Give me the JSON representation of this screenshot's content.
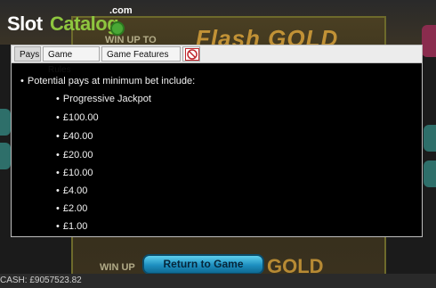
{
  "logo": {
    "slot": "Slot",
    "catalog": "Catalog",
    "com": ".com"
  },
  "background": {
    "title_top": "Flash GOLD",
    "winup_top": "WIN UP TO",
    "title_bottom": "GOLD",
    "winup_bottom": "WIN UP"
  },
  "tabs": [
    {
      "label": "Pays",
      "active": true
    },
    {
      "label": "Game Rules",
      "active": false
    },
    {
      "label": "Game Features",
      "active": false
    },
    {
      "label": "",
      "icon": "age-restriction-icon"
    }
  ],
  "pays": {
    "intro": "Potential pays at minimum bet include:",
    "items": [
      "Progressive Jackpot",
      "£100.00",
      "£40.00",
      "£20.00",
      "£10.00",
      "£4.00",
      "£2.00",
      "£1.00"
    ]
  },
  "return_button": "Return to Game",
  "status": {
    "cash": "CASH: £9057523.82"
  },
  "colors": {
    "logo_green": "#8ec63f",
    "button_blue": "#1d8fc0",
    "panel_bg": "#000000"
  }
}
